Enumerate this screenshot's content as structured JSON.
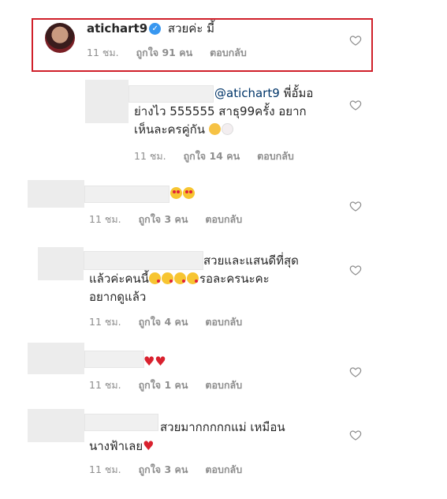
{
  "comments": [
    {
      "username": "atichart9",
      "text": "สวยค่ะ มี้",
      "time": "11 ชม.",
      "likes": "ถูกใจ 91 คน",
      "reply": "ตอบกลับ"
    },
    {
      "mention": "@atichart9",
      "line1_rest": "พี่อั้มอ",
      "line2": "ย่างไว 555555 สาธุ99ครั้ง อยาก",
      "line3": "เห็นละครคู่กัน",
      "time": "11 ชม.",
      "likes": "ถูกใจ 14 คน",
      "reply": "ตอบกลับ"
    },
    {
      "time": "11 ชม.",
      "likes": "ถูกใจ 3 คน",
      "reply": "ตอบกลับ"
    },
    {
      "line1": "สวยและแสนดีที่สุด",
      "line2_a": "แล้วค่ะคนนี้",
      "line2_b": "รอละครนะคะ",
      "line3": "อยากดูแล้ว",
      "time": "11 ชม.",
      "likes": "ถูกใจ 4 คน",
      "reply": "ตอบกลับ"
    },
    {
      "time": "11 ชม.",
      "likes": "ถูกใจ 1 คน",
      "reply": "ตอบกลับ"
    },
    {
      "line1": "สวยมากกกกกแม่ เหมือน",
      "line2": "นางฟ้าเลย",
      "time": "11 ชม.",
      "likes": "ถูกใจ 3 คน",
      "reply": "ตอบกลับ"
    }
  ],
  "colors": {
    "highlight_border": "#d0202a",
    "verified_badge": "#3897f0",
    "meta_text": "#8e8e8e"
  },
  "icons": {
    "like": "heart-outline-icon",
    "verified": "verified-badge-icon"
  }
}
